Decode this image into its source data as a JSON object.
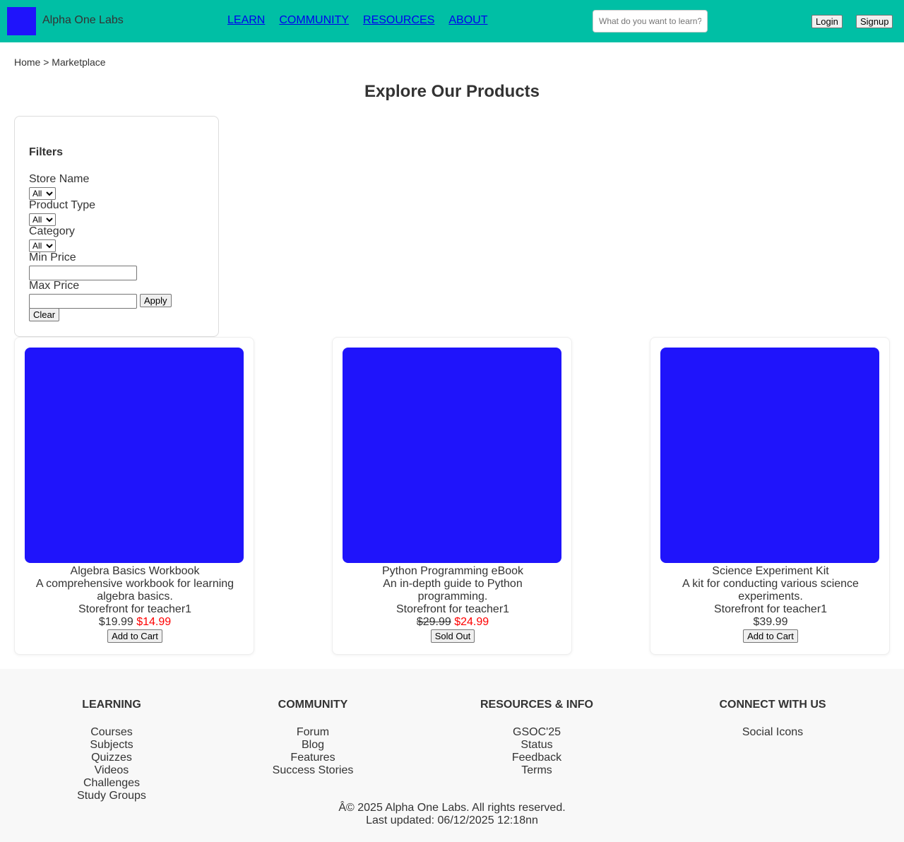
{
  "header": {
    "brand": "Alpha One Labs",
    "nav": [
      "LEARN",
      "COMMUNITY",
      "RESOURCES",
      "ABOUT"
    ],
    "search_placeholder": "What do you want to learn?",
    "login_label": "Login",
    "signup_label": "Signup",
    "logo_color": "#1f14fb",
    "bar_color": "#00bfa5"
  },
  "breadcrumb": "Home > Marketplace",
  "page_title": "Explore Our Products",
  "filters": {
    "title": "Filters",
    "store_name_label": "Store Name",
    "store_name_value": "All",
    "product_type_label": "Product Type",
    "product_type_value": "All",
    "category_label": "Category",
    "category_value": "All",
    "min_price_label": "Min Price",
    "min_price_value": "",
    "max_price_label": "Max Price",
    "max_price_value": "",
    "apply_label": "Apply",
    "clear_label": "Clear"
  },
  "products": [
    {
      "name": "Algebra Basics Workbook",
      "description": "A comprehensive workbook for learning algebra basics.",
      "store": "Storefront for teacher1",
      "price": "$19.99",
      "price_struck": false,
      "sale_price": "$14.99",
      "button": "Add to Cart"
    },
    {
      "name": "Python Programming eBook",
      "description": "An in-depth guide to Python programming.",
      "store": "Storefront for teacher1",
      "price": "$29.99",
      "price_struck": true,
      "sale_price": "$24.99",
      "button": "Sold Out"
    },
    {
      "name": "Science Experiment Kit",
      "description": "A kit for conducting various science experiments.",
      "store": "Storefront for teacher1",
      "price": "$39.99",
      "price_struck": false,
      "sale_price": "",
      "button": "Add to Cart"
    }
  ],
  "footer": {
    "learning": {
      "title": "LEARNING",
      "links": [
        "Courses",
        "Subjects",
        "Quizzes",
        "Videos",
        "Challenges",
        "Study Groups"
      ]
    },
    "community": {
      "title": "COMMUNITY",
      "links": [
        "Forum",
        "Blog",
        "Features",
        "Success Stories"
      ]
    },
    "resources": {
      "title": "RESOURCES & INFO",
      "links": [
        "GSOC'25",
        "Status",
        "Feedback",
        "Terms"
      ]
    },
    "connect": {
      "title": "CONNECT WITH US",
      "links": [
        "Social Icons"
      ]
    },
    "copyright": "Â© 2025 Alpha One Labs. All rights reserved.",
    "last_updated": "Last updated: 06/12/2025 12:18nn"
  }
}
